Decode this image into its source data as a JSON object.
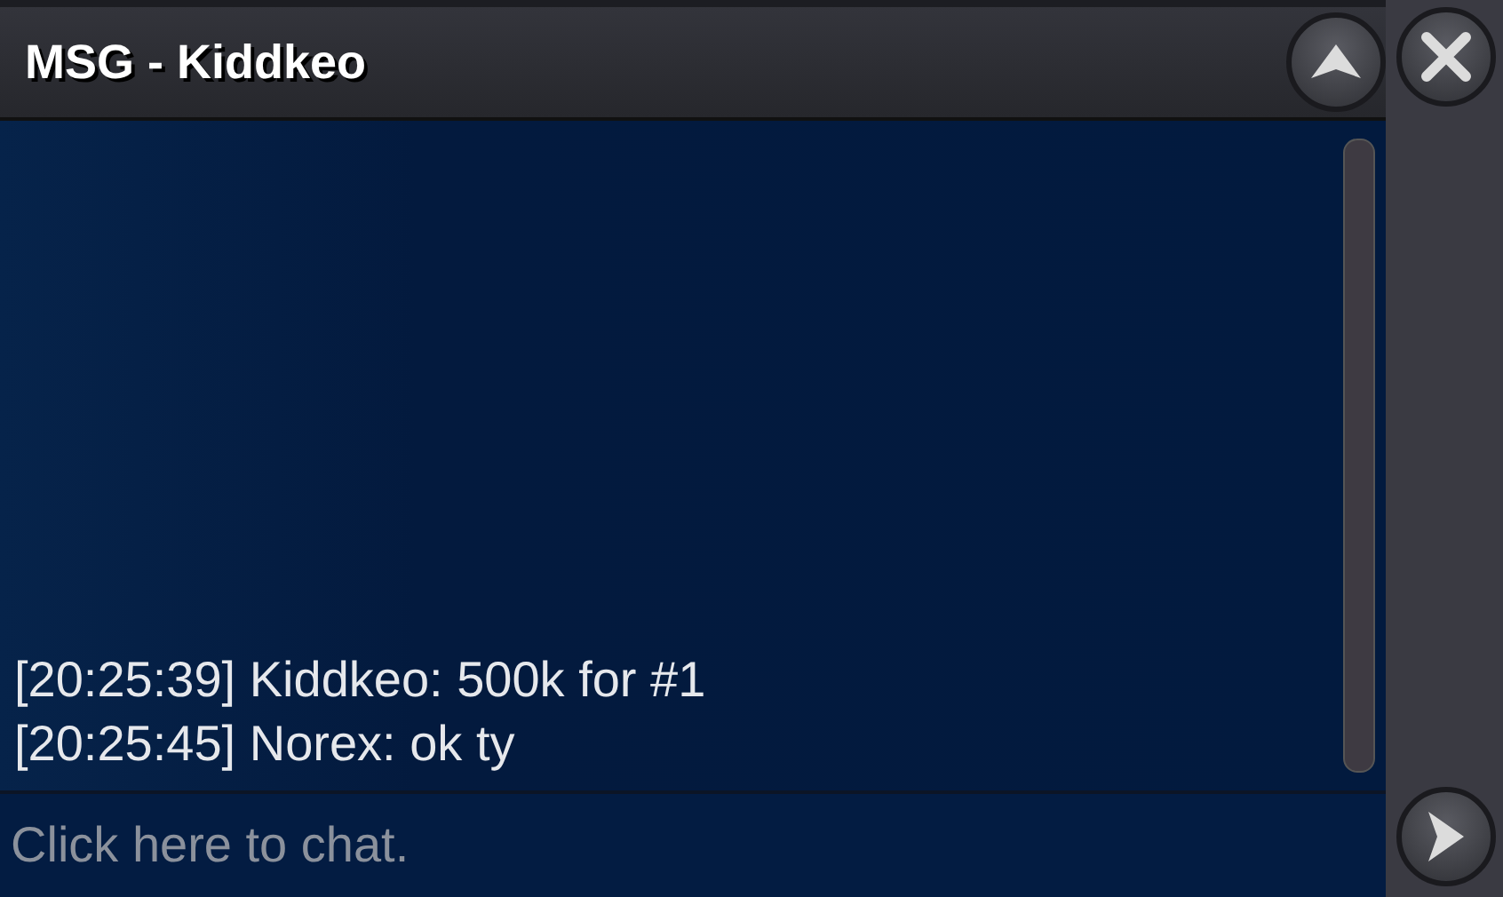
{
  "window": {
    "title": "MSG - Kiddkeo"
  },
  "messages": [
    {
      "time": "[20:25:39]",
      "text": "Kiddkeo: 500k for #1"
    },
    {
      "time": "[20:25:45]",
      "text": "Norex: ok ty"
    }
  ],
  "chat_input": {
    "placeholder": "Click here to chat."
  }
}
